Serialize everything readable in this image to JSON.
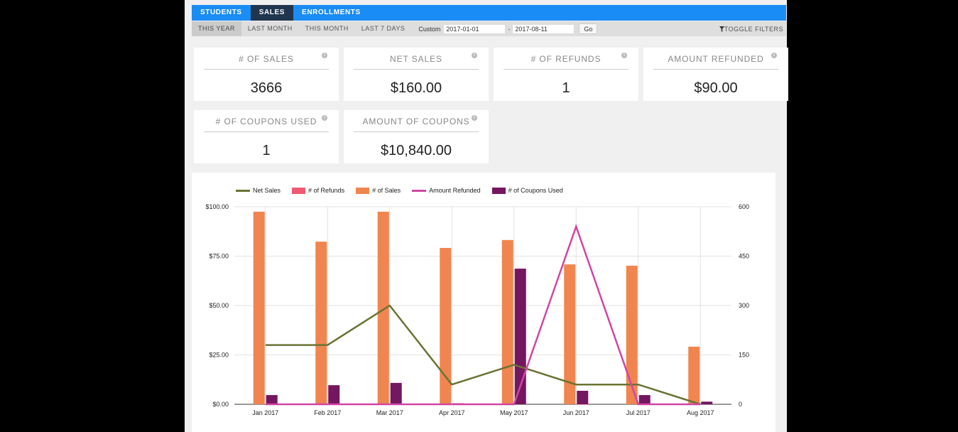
{
  "nav": {
    "tabs": [
      {
        "label": "STUDENTS",
        "active": false
      },
      {
        "label": "SALES",
        "active": true
      },
      {
        "label": "ENROLLMENTS",
        "active": false
      }
    ]
  },
  "filters": {
    "periods": [
      {
        "label": "THIS YEAR",
        "active": true
      },
      {
        "label": "LAST MONTH",
        "active": false
      },
      {
        "label": "THIS MONTH",
        "active": false
      },
      {
        "label": "LAST 7 DAYS",
        "active": false
      }
    ],
    "custom_label": "Custom",
    "start_date": "2017-01-01",
    "end_date": "2017-08-11",
    "separator": "-",
    "go_label": "Go",
    "toggle_label": "TOGGLE FILTERS",
    "toggle_icon": "filter-icon"
  },
  "cards": [
    {
      "title": "# OF SALES",
      "value": "3666",
      "icon": "info-icon"
    },
    {
      "title": "NET SALES",
      "value": "$160.00",
      "icon": "info-icon"
    },
    {
      "title": "# OF REFUNDS",
      "value": "1",
      "icon": "info-icon"
    },
    {
      "title": "AMOUNT REFUNDED",
      "value": "$90.00",
      "icon": "info-icon"
    },
    {
      "title": "# OF COUPONS USED",
      "value": "1",
      "icon": "info-icon"
    },
    {
      "title": "AMOUNT OF COUPONS",
      "value": "$10,840.00",
      "icon": "info-icon"
    }
  ],
  "chart_data": {
    "type": "bar",
    "title": "",
    "categories": [
      "Jan 2017",
      "Feb 2017",
      "Mar 2017",
      "Apr 2017",
      "May 2017",
      "Jun 2017",
      "Jul 2017",
      "Aug 2017"
    ],
    "left_axis": {
      "ticks": [
        "$0.00",
        "$25.00",
        "$50.00",
        "$75.00",
        "$100.00"
      ],
      "range": [
        0,
        100
      ]
    },
    "right_axis": {
      "ticks": [
        "0",
        "150",
        "300",
        "450",
        "600"
      ],
      "range": [
        0,
        600
      ]
    },
    "grid": true,
    "legend_position": "top-left",
    "series": [
      {
        "name": "Net Sales",
        "kind": "line",
        "axis": "left",
        "color": "#6b7233",
        "values": [
          30,
          30,
          50,
          10,
          20,
          10,
          10,
          0
        ]
      },
      {
        "name": "# of Refunds",
        "kind": "bar",
        "axis": "right",
        "color": "#ee5a72",
        "values": [
          0,
          0,
          0,
          0,
          0,
          1,
          0,
          0
        ]
      },
      {
        "name": "# of Sales",
        "kind": "bar",
        "axis": "right",
        "color": "#f0854f",
        "values": [
          585,
          494,
          585,
          475,
          499,
          425,
          421,
          175
        ]
      },
      {
        "name": "Amount Refunded",
        "kind": "line",
        "axis": "left",
        "color": "#d046a4",
        "values": [
          0,
          0,
          0,
          0,
          0,
          90,
          0,
          0
        ]
      },
      {
        "name": "# of Coupons Used",
        "kind": "bar",
        "axis": "right",
        "color": "#751660",
        "values": [
          28,
          58,
          65,
          3,
          412,
          41,
          28,
          8
        ]
      }
    ]
  }
}
